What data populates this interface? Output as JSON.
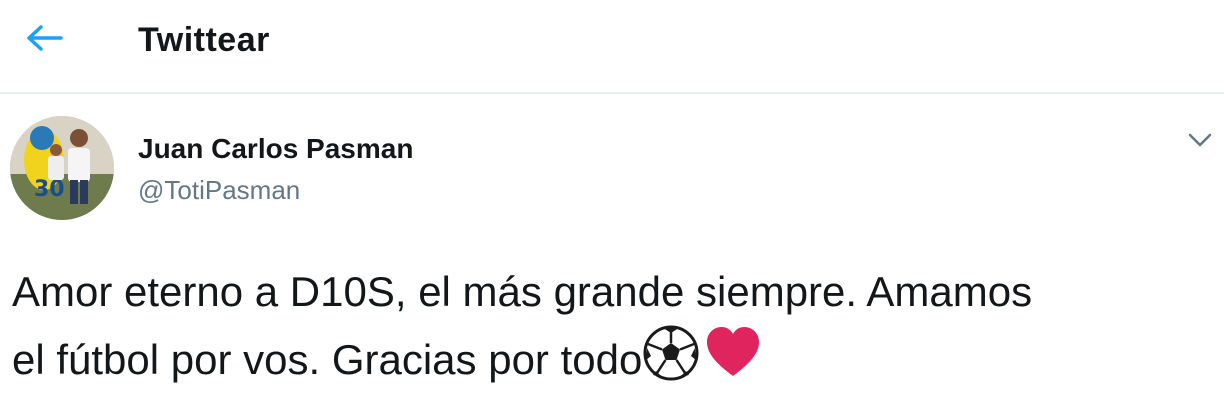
{
  "header": {
    "title": "Twittear",
    "back_icon": "arrow-left-icon"
  },
  "tweet": {
    "author": {
      "name": "Juan Carlos Pasman",
      "handle": "@TotiPasman"
    },
    "text_line_1": "Amor eterno a D10S, el más grande siempre. Amamos",
    "text_line_2": "el fútbol por vos. Gracias por todo",
    "emojis": [
      "soccer-ball-icon",
      "red-heart-icon"
    ],
    "menu_icon": "chevron-down-icon"
  },
  "colors": {
    "accent": "#1da1f2",
    "text": "#14171a",
    "secondary_text": "#657786",
    "divider": "#e6ecf0",
    "heart": "#e0245e"
  }
}
